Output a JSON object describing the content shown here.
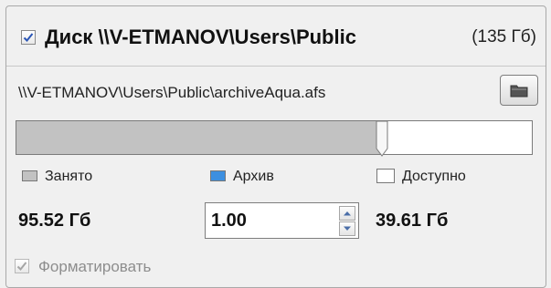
{
  "disk": {
    "checked": true,
    "title": "Диск \\\\V-ETMANOV\\Users\\Public",
    "size": "(135 Гб)"
  },
  "archive": {
    "path": "\\\\V-ETMANOV\\Users\\Public\\archiveAqua.afs",
    "browse_icon": "folder-icon"
  },
  "usage_bar": {
    "occupied_fraction": 0.71,
    "colors": {
      "occupied": "#c2c2c2",
      "archive": "#3c8fe0",
      "available": "#ffffff"
    }
  },
  "legend": {
    "occupied_label": "Занято",
    "archive_label": "Архив",
    "available_label": "Доступно"
  },
  "values": {
    "occupied": "95.52 Гб",
    "archive_input": "1.00",
    "available": "39.61 Гб"
  },
  "format": {
    "checked": true,
    "enabled": false,
    "label": "Форматировать"
  }
}
